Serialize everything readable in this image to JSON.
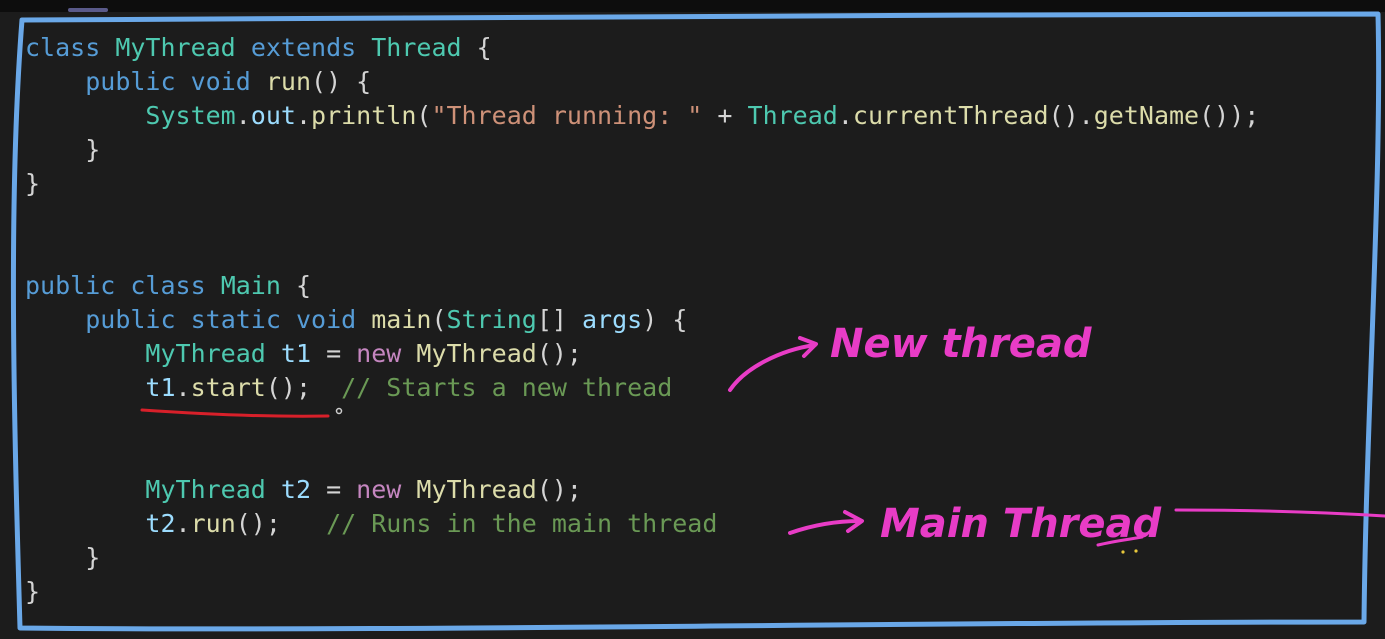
{
  "colors": {
    "background": "#1c1c1c",
    "frame_outline": "#6aa8e8",
    "annotation_pink": "#e83cc6",
    "underline_red": "#d8202a"
  },
  "code_lines": [
    [
      {
        "t": "class",
        "c": "kw"
      },
      {
        "t": " ",
        "c": "pn"
      },
      {
        "t": "MyThread",
        "c": "ty"
      },
      {
        "t": " ",
        "c": "pn"
      },
      {
        "t": "extends",
        "c": "kw"
      },
      {
        "t": " ",
        "c": "pn"
      },
      {
        "t": "Thread",
        "c": "ty"
      },
      {
        "t": " {",
        "c": "pn"
      }
    ],
    [
      {
        "t": "    ",
        "c": "pn"
      },
      {
        "t": "public",
        "c": "kw"
      },
      {
        "t": " ",
        "c": "pn"
      },
      {
        "t": "void",
        "c": "kw"
      },
      {
        "t": " ",
        "c": "pn"
      },
      {
        "t": "run",
        "c": "fn"
      },
      {
        "t": "() {",
        "c": "pn"
      }
    ],
    [
      {
        "t": "        ",
        "c": "pn"
      },
      {
        "t": "System",
        "c": "ty"
      },
      {
        "t": ".",
        "c": "pn"
      },
      {
        "t": "out",
        "c": "var"
      },
      {
        "t": ".",
        "c": "pn"
      },
      {
        "t": "println",
        "c": "fn"
      },
      {
        "t": "(",
        "c": "pn"
      },
      {
        "t": "\"Thread running: \"",
        "c": "str"
      },
      {
        "t": " + ",
        "c": "pn"
      },
      {
        "t": "Thread",
        "c": "ty"
      },
      {
        "t": ".",
        "c": "pn"
      },
      {
        "t": "currentThread",
        "c": "fn"
      },
      {
        "t": "().",
        "c": "pn"
      },
      {
        "t": "getName",
        "c": "fn"
      },
      {
        "t": "());",
        "c": "pn"
      }
    ],
    [
      {
        "t": "    }",
        "c": "pn"
      }
    ],
    [
      {
        "t": "}",
        "c": "pn"
      }
    ],
    [],
    [],
    [
      {
        "t": "public",
        "c": "kw"
      },
      {
        "t": " ",
        "c": "pn"
      },
      {
        "t": "class",
        "c": "kw"
      },
      {
        "t": " ",
        "c": "pn"
      },
      {
        "t": "Main",
        "c": "ty"
      },
      {
        "t": " {",
        "c": "pn"
      }
    ],
    [
      {
        "t": "    ",
        "c": "pn"
      },
      {
        "t": "public",
        "c": "kw"
      },
      {
        "t": " ",
        "c": "pn"
      },
      {
        "t": "static",
        "c": "kw"
      },
      {
        "t": " ",
        "c": "pn"
      },
      {
        "t": "void",
        "c": "kw"
      },
      {
        "t": " ",
        "c": "pn"
      },
      {
        "t": "main",
        "c": "fn"
      },
      {
        "t": "(",
        "c": "pn"
      },
      {
        "t": "String",
        "c": "ty"
      },
      {
        "t": "[] ",
        "c": "pn"
      },
      {
        "t": "args",
        "c": "var"
      },
      {
        "t": ") {",
        "c": "pn"
      }
    ],
    [
      {
        "t": "        ",
        "c": "pn"
      },
      {
        "t": "MyThread",
        "c": "ty"
      },
      {
        "t": " ",
        "c": "pn"
      },
      {
        "t": "t1",
        "c": "var"
      },
      {
        "t": " = ",
        "c": "pn"
      },
      {
        "t": "new",
        "c": "nw"
      },
      {
        "t": " ",
        "c": "pn"
      },
      {
        "t": "MyThread",
        "c": "fn"
      },
      {
        "t": "();",
        "c": "pn"
      }
    ],
    [
      {
        "t": "        ",
        "c": "pn"
      },
      {
        "t": "t1",
        "c": "var"
      },
      {
        "t": ".",
        "c": "pn"
      },
      {
        "t": "start",
        "c": "fn"
      },
      {
        "t": "();  ",
        "c": "pn"
      },
      {
        "t": "// Starts a new thread",
        "c": "cm"
      }
    ],
    [],
    [],
    [
      {
        "t": "        ",
        "c": "pn"
      },
      {
        "t": "MyThread",
        "c": "ty"
      },
      {
        "t": " ",
        "c": "pn"
      },
      {
        "t": "t2",
        "c": "var"
      },
      {
        "t": " = ",
        "c": "pn"
      },
      {
        "t": "new",
        "c": "nw"
      },
      {
        "t": " ",
        "c": "pn"
      },
      {
        "t": "MyThread",
        "c": "fn"
      },
      {
        "t": "();",
        "c": "pn"
      }
    ],
    [
      {
        "t": "        ",
        "c": "pn"
      },
      {
        "t": "t2",
        "c": "var"
      },
      {
        "t": ".",
        "c": "pn"
      },
      {
        "t": "run",
        "c": "fn"
      },
      {
        "t": "();   ",
        "c": "pn"
      },
      {
        "t": "// Runs in the main thread",
        "c": "cm"
      }
    ],
    [
      {
        "t": "    }",
        "c": "pn"
      }
    ],
    [
      {
        "t": "}",
        "c": "pn"
      }
    ]
  ],
  "annotations": {
    "new_thread_label": "New thread",
    "main_thread_label": "Main Thread"
  }
}
